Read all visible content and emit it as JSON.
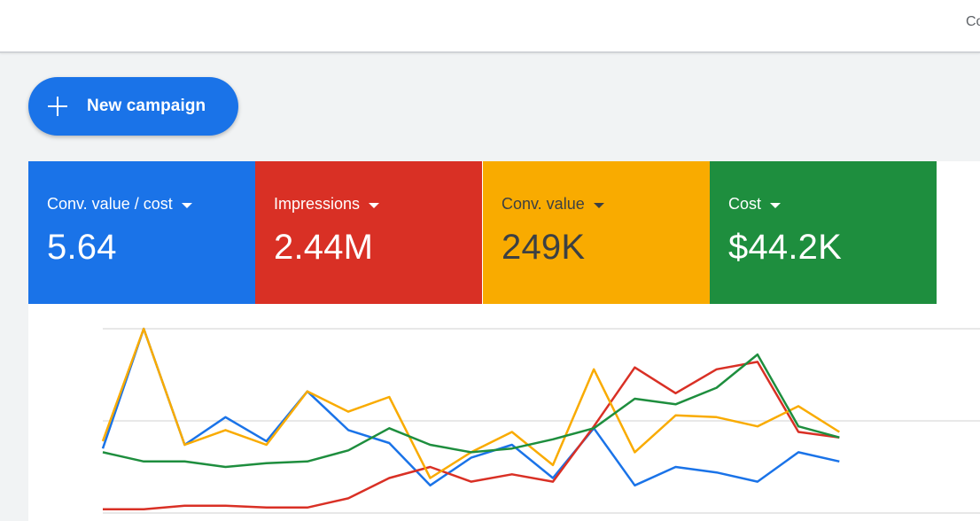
{
  "header": {
    "cut_text": "Co"
  },
  "new_campaign": {
    "label": "New campaign"
  },
  "metric_cards": [
    {
      "label": "Conv. value / cost",
      "value": "5.64",
      "color": "#1a73e8",
      "text_color": "#ffffff"
    },
    {
      "label": "Impressions",
      "value": "2.44M",
      "color": "#d93025",
      "text_color": "#ffffff"
    },
    {
      "label": "Conv. value",
      "value": "249K",
      "color": "#f9ab00",
      "text_color": "#3c4043"
    },
    {
      "label": "Cost",
      "value": "$44.2K",
      "color": "#1e8e3e",
      "text_color": "#ffffff"
    }
  ],
  "chart_data": {
    "type": "line",
    "x": [
      0,
      1,
      2,
      3,
      4,
      5,
      6,
      7,
      8,
      9,
      10,
      11,
      12,
      13,
      14,
      15,
      16,
      17,
      18,
      19,
      20,
      21,
      22
    ],
    "ylim": [
      0,
      1
    ],
    "grid": true,
    "series": [
      {
        "color": "#1a73e8",
        "values": [
          0.35,
          1.0,
          0.37,
          0.52,
          0.39,
          0.66,
          0.45,
          0.38,
          0.15,
          0.3,
          0.37,
          0.19,
          0.46,
          0.15,
          0.25,
          0.22,
          0.17,
          0.33,
          0.28
        ]
      },
      {
        "color": "#d93025",
        "values": [
          0.02,
          0.02,
          0.04,
          0.04,
          0.03,
          0.03,
          0.08,
          0.19,
          0.25,
          0.17,
          0.21,
          0.17,
          0.47,
          0.79,
          0.65,
          0.78,
          0.82,
          0.44,
          0.41
        ]
      },
      {
        "color": "#f9ab00",
        "values": [
          0.39,
          1.0,
          0.37,
          0.45,
          0.37,
          0.66,
          0.55,
          0.63,
          0.19,
          0.33,
          0.44,
          0.26,
          0.78,
          0.33,
          0.53,
          0.52,
          0.47,
          0.58,
          0.44
        ]
      },
      {
        "color": "#1e8e3e",
        "values": [
          0.33,
          0.28,
          0.28,
          0.25,
          0.27,
          0.28,
          0.34,
          0.46,
          0.37,
          0.33,
          0.35,
          0.4,
          0.46,
          0.62,
          0.59,
          0.68,
          0.86,
          0.47,
          0.41
        ]
      }
    ]
  }
}
